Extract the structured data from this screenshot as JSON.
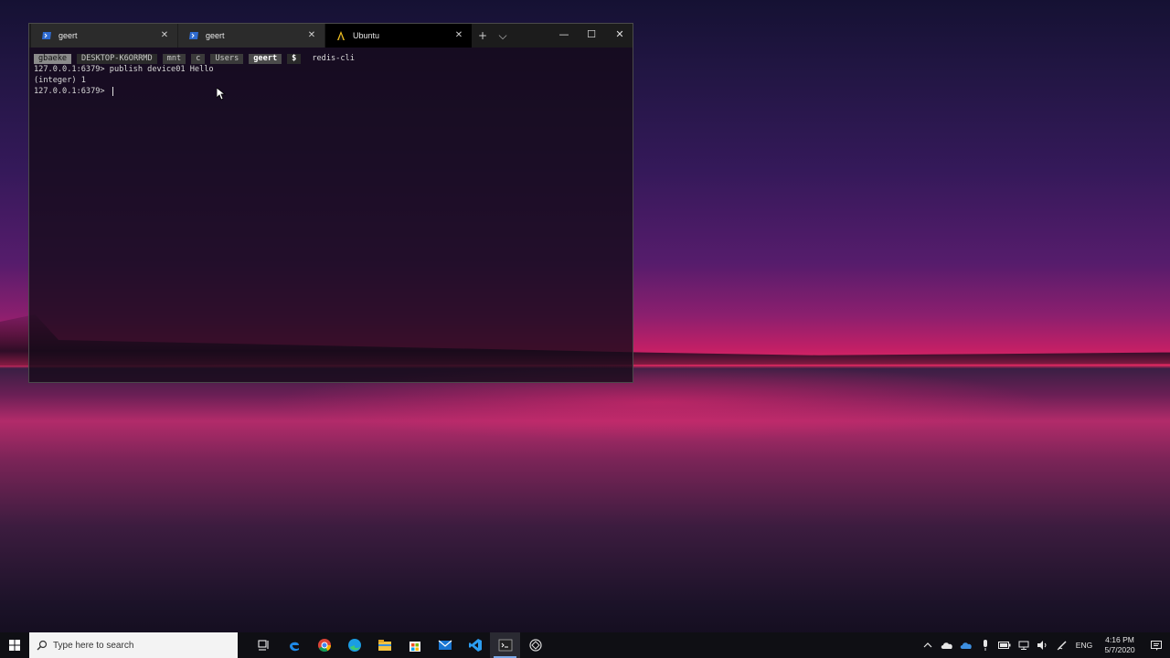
{
  "terminal": {
    "tabs": [
      {
        "label": "geert",
        "icon": "powershell-icon",
        "active": false
      },
      {
        "label": "geert",
        "icon": "powershell-icon",
        "active": false
      },
      {
        "label": "Ubuntu",
        "icon": "ubuntu-linux-icon",
        "active": true
      }
    ],
    "new_tab_symbol": "+",
    "dropdown_symbol": "⌵",
    "window_controls": {
      "minimize": "—",
      "maximize": "☐",
      "close": "✕"
    },
    "prompt": {
      "user": "gbaeke",
      "host": "DESKTOP-K6ORRMD",
      "path": [
        "mnt",
        "c",
        "Users"
      ],
      "dir": "geert",
      "symbol": "$",
      "command": "redis-cli"
    },
    "output_lines": [
      "127.0.0.1:6379> publish device01 Hello",
      "(integer) 1",
      "127.0.0.1:6379> "
    ]
  },
  "taskbar": {
    "search_placeholder": "Type here to search",
    "apps": [
      {
        "name": "task-view-icon",
        "active": false
      },
      {
        "name": "edge-legacy-icon",
        "active": false
      },
      {
        "name": "chrome-icon",
        "active": false
      },
      {
        "name": "edge-icon",
        "active": false
      },
      {
        "name": "file-explorer-icon",
        "active": false
      },
      {
        "name": "store-icon",
        "active": false
      },
      {
        "name": "mail-icon",
        "active": false
      },
      {
        "name": "vscode-icon",
        "active": false
      },
      {
        "name": "terminal-icon",
        "active": true
      },
      {
        "name": "app-icon",
        "active": false
      }
    ],
    "tray": {
      "language": "ENG",
      "time": "4:16 PM",
      "date": "5/7/2020"
    }
  },
  "colors": {
    "accent": "#7aa8e8",
    "terminal_bg": "#140a18",
    "taskbar_bg": "#0f0f14"
  }
}
